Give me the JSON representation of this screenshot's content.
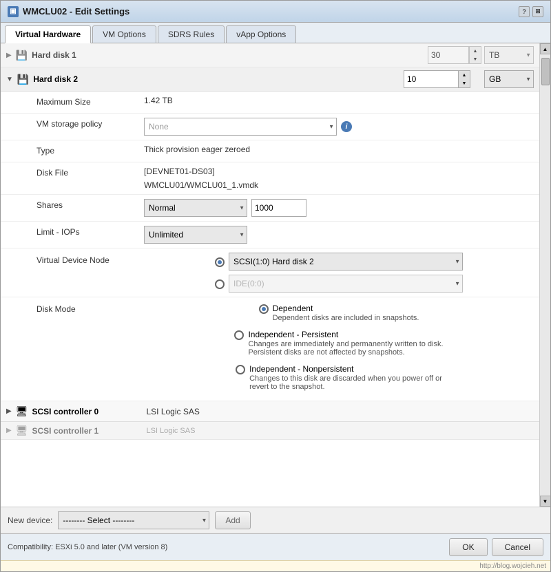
{
  "window": {
    "title": "WMCLU02 - Edit Settings",
    "icon": "VM"
  },
  "tabs": [
    {
      "id": "virtual-hardware",
      "label": "Virtual Hardware",
      "active": true
    },
    {
      "id": "vm-options",
      "label": "VM Options",
      "active": false
    },
    {
      "id": "sdrs-rules",
      "label": "SDRS Rules",
      "active": false
    },
    {
      "id": "vapp-options",
      "label": "vApp Options",
      "active": false
    }
  ],
  "hard_disk_1": {
    "label": "Hard disk 1",
    "collapsed": true,
    "value": "30",
    "unit": "TB"
  },
  "hard_disk_2": {
    "label": "Hard disk 2",
    "size_value": "10",
    "size_unit": "GB",
    "max_size_label": "Maximum Size",
    "max_size_value": "1.42 TB",
    "vm_storage_policy_label": "VM storage policy",
    "vm_storage_policy_value": "None",
    "type_label": "Type",
    "type_value": "Thick provision eager zeroed",
    "disk_file_label": "Disk File",
    "disk_file_line1": "[DEVNET01-DS03]",
    "disk_file_line2": "WMCLU01/WMCLU01_1.vmdk",
    "shares_label": "Shares",
    "shares_mode": "Normal",
    "shares_value": "1000",
    "limit_iops_label": "Limit - IOPs",
    "limit_iops_value": "Unlimited",
    "virtual_device_node_label": "Virtual Device Node",
    "vdn_option1": "SCSI(1:0) Hard disk 2",
    "vdn_option2": "IDE(0:0)",
    "disk_mode_label": "Disk Mode",
    "disk_modes": [
      {
        "id": "dependent",
        "label": "Dependent",
        "desc": "Dependent disks are included in snapshots.",
        "selected": true
      },
      {
        "id": "independent-persistent",
        "label": "Independent - Persistent",
        "desc": "Changes are immediately and permanently written to disk.\nPersistent disks are not affected by snapshots.",
        "selected": false
      },
      {
        "id": "independent-nonpersistent",
        "label": "Independent - Nonpersistent",
        "desc": "Changes to this disk are discarded when you power off or\nrevert to the snapshot.",
        "selected": false
      }
    ]
  },
  "scsi_controller_0": {
    "label": "SCSI controller 0",
    "value": "LSI Logic SAS"
  },
  "scsi_controller_1": {
    "label": "SCSI controller 1",
    "value": "LSI Logic SAS",
    "partial": true
  },
  "new_device": {
    "label": "New device:",
    "select_placeholder": "-------- Select --------",
    "add_button": "Add"
  },
  "footer": {
    "compatibility": "Compatibility: ESXi 5.0 and later (VM version 8)",
    "ok_button": "OK",
    "cancel_button": "Cancel"
  },
  "url": "http://blog.wojcieh.net"
}
